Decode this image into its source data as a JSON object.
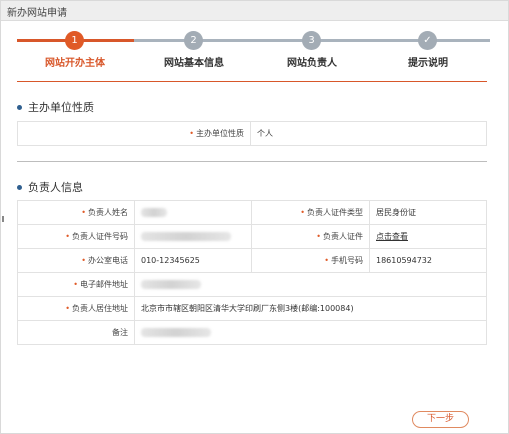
{
  "window": {
    "title": "新办网站申请"
  },
  "steps": [
    {
      "number": "1",
      "label": "网站开办主体",
      "state": "active"
    },
    {
      "number": "2",
      "label": "网站基本信息",
      "state": "todo"
    },
    {
      "number": "3",
      "label": "网站负责人",
      "state": "todo"
    },
    {
      "number": "✓",
      "label": "提示说明",
      "state": "todo"
    }
  ],
  "section_org": {
    "title": "主办单位性质",
    "label": "主办单位性质",
    "value": "个人"
  },
  "section_person": {
    "title": "负责人信息",
    "rows": {
      "name_label": "负责人姓名",
      "id_type_label": "负责人证件类型",
      "id_type_value": "居民身份证",
      "id_number_label": "负责人证件号码",
      "id_doc_label": "负责人证件",
      "id_doc_link": "点击查看",
      "office_phone_label": "办公室电话",
      "office_phone_value": "010-12345625",
      "mobile_label": "手机号码",
      "mobile_value": "18610594732",
      "email_label": "电子邮件地址",
      "address_label": "负责人居住地址",
      "address_value": "北京市市辖区朝阳区清华大学印刷厂东侧3楼(邮编:100084)",
      "note_label": "备注"
    }
  },
  "actions": {
    "next_label": "下一步"
  },
  "colors": {
    "accent": "#d8572a",
    "step_todo": "#a3acb5",
    "section_dot": "#2f5f8f"
  },
  "icons": {
    "done_step": "checkmark-icon"
  }
}
